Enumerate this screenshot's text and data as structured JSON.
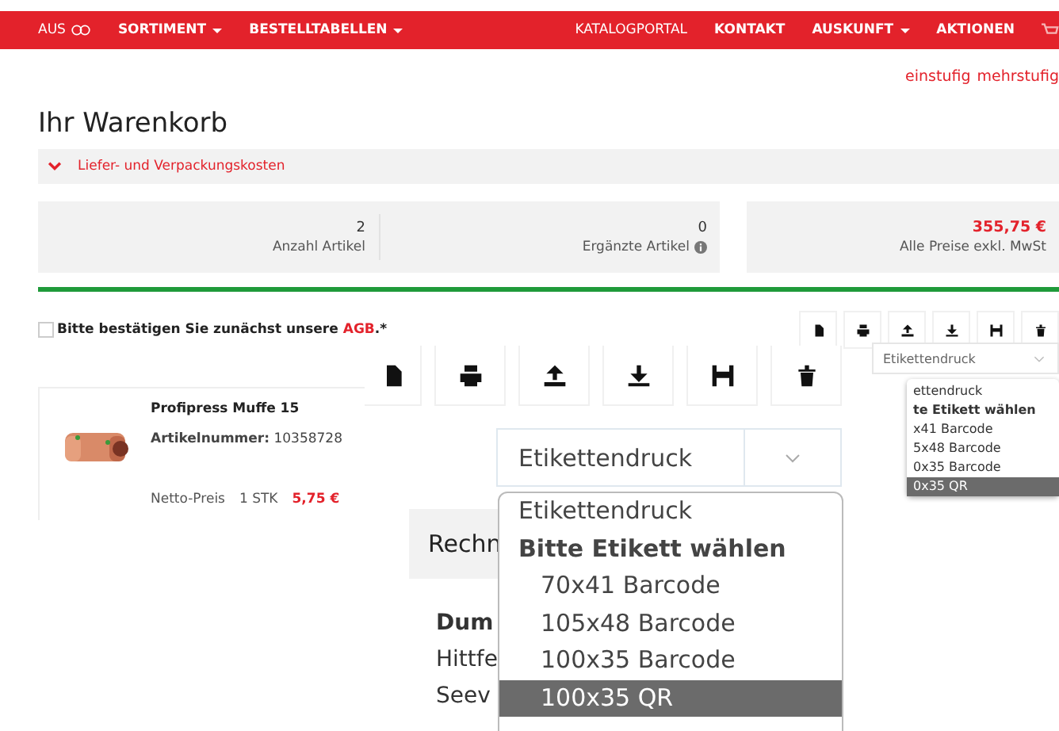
{
  "nav": {
    "left": [
      {
        "label": "AUS",
        "kind": "toggle"
      },
      {
        "label": "SORTIMENT",
        "kind": "dropdown"
      },
      {
        "label": "BESTELLTABELLEN",
        "kind": "dropdown"
      }
    ],
    "right": [
      {
        "label": "KATALOGPORTAL",
        "kind": "link"
      },
      {
        "label": "KONTAKT",
        "kind": "link"
      },
      {
        "label": "AUSKUNFT",
        "kind": "dropdown"
      },
      {
        "label": "AKTIONEN",
        "kind": "link"
      }
    ]
  },
  "view_links": [
    "einstufig",
    "mehrstufig"
  ],
  "title": "Ihr Warenkorb",
  "accordion": {
    "label": "Liefer- und Verpackungskosten",
    "expanded": true
  },
  "summary": [
    {
      "value": "2",
      "label": "Anzahl Artikel",
      "info": false
    },
    {
      "value": "0",
      "label": "Ergänzte Artikel",
      "info": true
    }
  ],
  "total": {
    "value": "355,75 €",
    "label": "Alle Preise exkl. MwSt"
  },
  "agb": {
    "text": "Bitte bestätigen Sie zunächst unsere ",
    "link": "AGB",
    "suffix": ".*",
    "checked": false
  },
  "label_select": {
    "value": "Etikettendruck",
    "options": [
      {
        "label": "ettendruck",
        "kind": "placeholder",
        "selected": false
      },
      {
        "label": "te Etikett wählen",
        "kind": "group",
        "selected": false
      },
      {
        "label": "x41 Barcode",
        "kind": "option",
        "selected": false
      },
      {
        "label": "5x48 Barcode",
        "kind": "option",
        "selected": false
      },
      {
        "label": "0x35 Barcode",
        "kind": "option",
        "selected": false
      },
      {
        "label": "0x35 QR",
        "kind": "option",
        "selected": true
      }
    ]
  },
  "product": {
    "name": "Profipress Muffe 15",
    "article_label": "Artikelnummer:",
    "article_number": "10358728",
    "price_label": "Netto-Preis",
    "quantity": "1 STK",
    "price": "5,75 €"
  },
  "magnified": {
    "select_value": "Etikettendruck",
    "options": [
      {
        "label": "Etikettendruck",
        "kind": "placeholder",
        "selected": false
      },
      {
        "label": "Bitte Etikett wählen",
        "kind": "group",
        "selected": false
      },
      {
        "label": "70x41 Barcode",
        "kind": "option",
        "selected": false
      },
      {
        "label": "105x48 Barcode",
        "kind": "option",
        "selected": false
      },
      {
        "label": "100x35 Barcode",
        "kind": "option",
        "selected": false
      },
      {
        "label": "100x35 QR",
        "kind": "option",
        "selected": true
      }
    ],
    "panel_heading": "Rechn",
    "bold_text": "Dum",
    "lines": [
      "Hittfe",
      "Seev"
    ]
  }
}
